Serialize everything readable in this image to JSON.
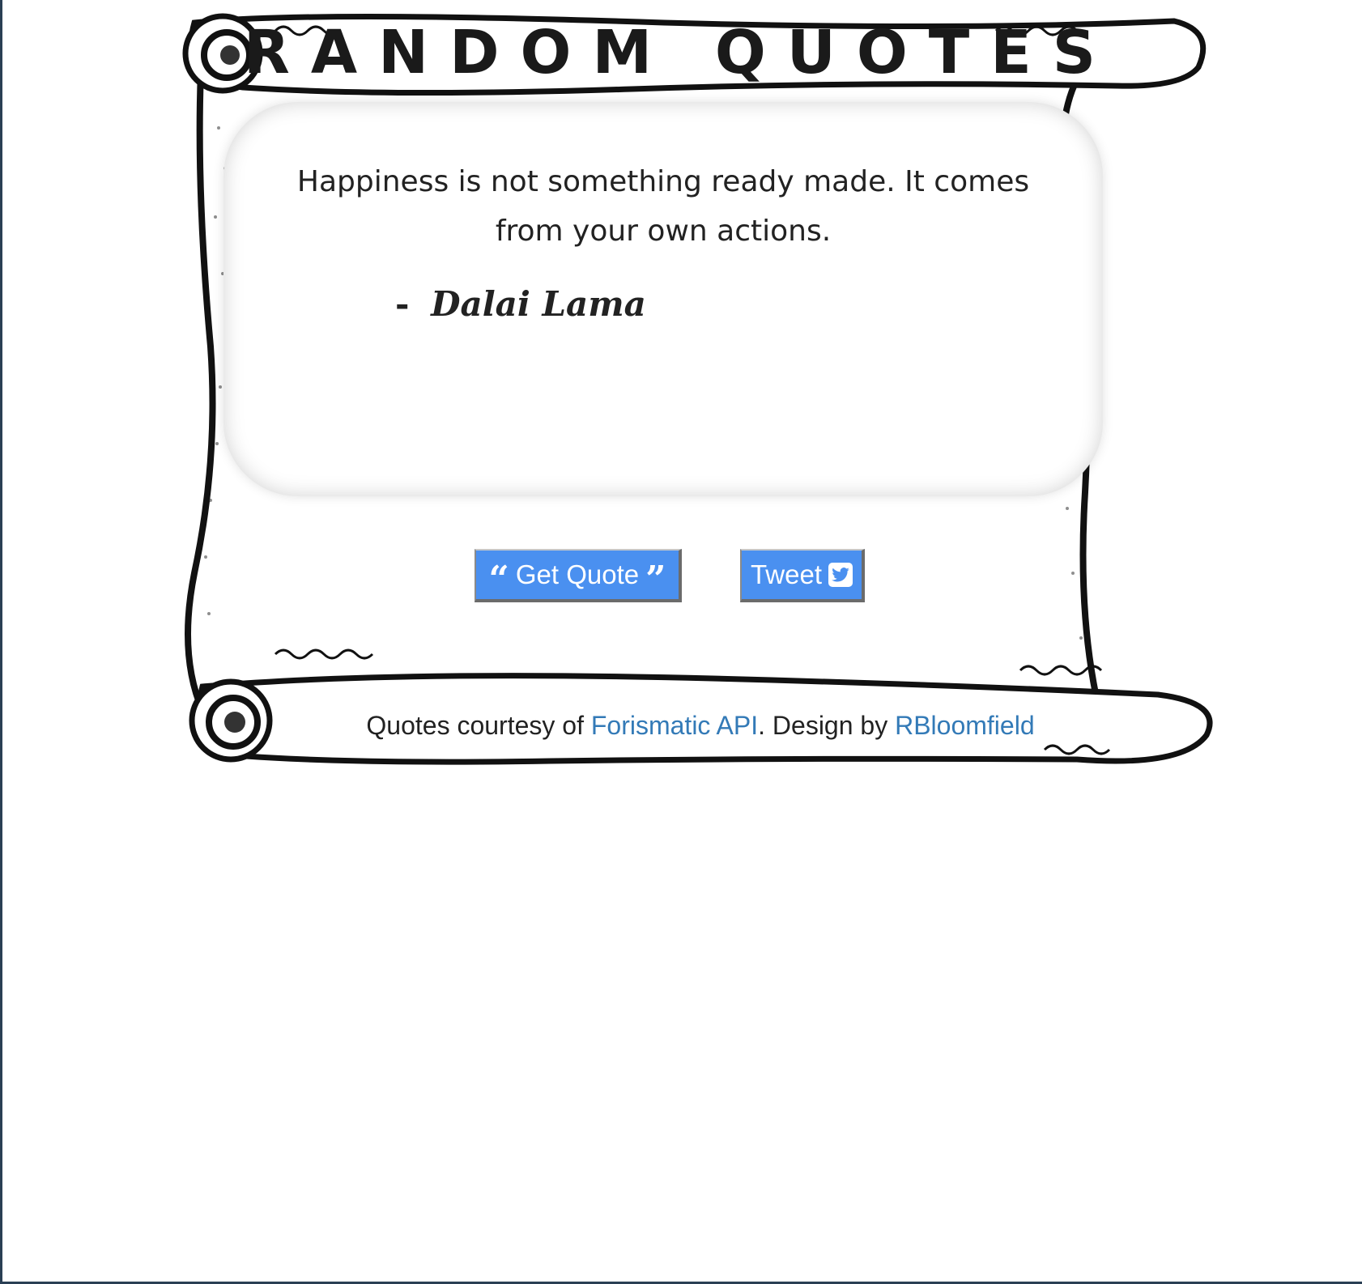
{
  "header": {
    "title": "RANDOM QUOTES"
  },
  "quote": {
    "text": "Happiness is not something ready made. It comes from your own actions.",
    "author": "Dalai Lama",
    "dash": "-"
  },
  "buttons": {
    "get_quote": "Get Quote",
    "tweet": "Tweet"
  },
  "footer": {
    "prefix": "Quotes courtesy of ",
    "api_link": "Forismatic API",
    "middle": ".   Design by ",
    "designer_link": "RBloomfield"
  },
  "colors": {
    "button": "#4a90f0",
    "link": "#337ab7",
    "text": "#222222",
    "frame": "#2a3f54"
  },
  "icons": {
    "open_quote": "quote-left-icon",
    "close_quote": "quote-right-icon",
    "twitter": "twitter-square-icon"
  }
}
